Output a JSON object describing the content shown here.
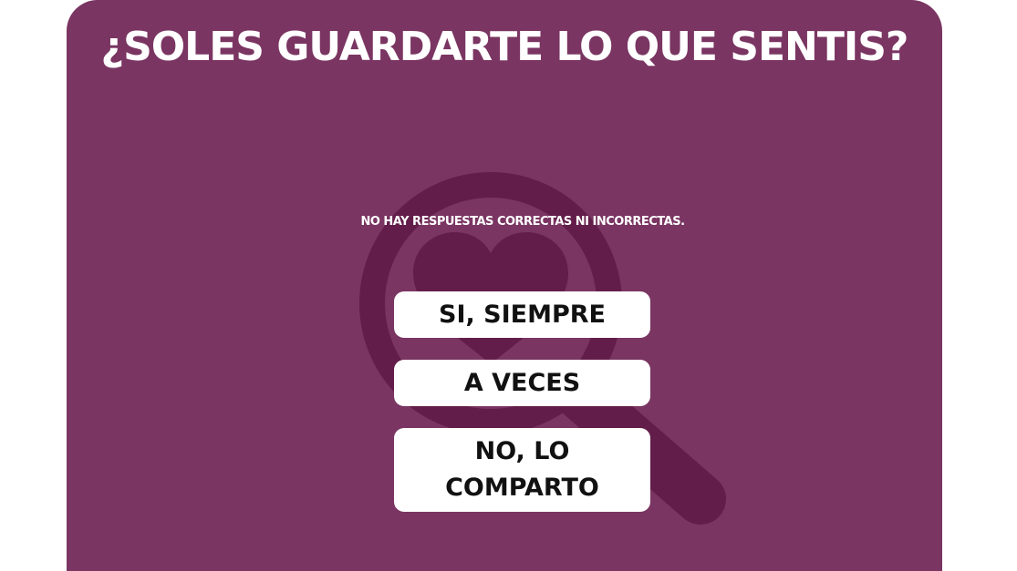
{
  "quiz": {
    "question": "¿SOLES GUARDARTE LO QUE SENTIS?",
    "hint": "NO HAY RESPUESTAS CORRECTAS NI INCORRECTAS.",
    "options": [
      {
        "label": "SI, SIEMPRE"
      },
      {
        "label": "A VECES"
      },
      {
        "label": "NO, LO COMPARTO"
      }
    ]
  },
  "colors": {
    "card_background": "#7a3562",
    "icon_shade": "#631d4a",
    "button_background": "#ffffff",
    "button_text": "#111111",
    "title_text": "#ffffff"
  },
  "icons": {
    "background": "magnifier-heart-icon"
  }
}
